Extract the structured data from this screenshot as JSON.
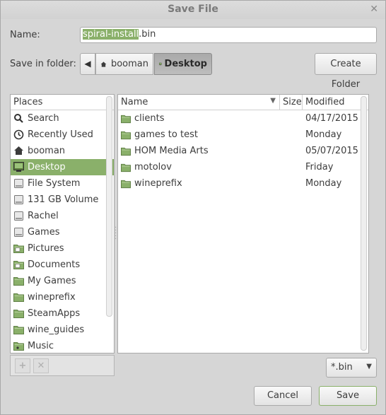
{
  "window": {
    "title": "Save File"
  },
  "name_field": {
    "label": "Name:",
    "selected_text": "spiral-install",
    "rest_text": ".bin"
  },
  "save_in": {
    "label": "Save in folder:",
    "crumbs": [
      "booman",
      "Desktop"
    ]
  },
  "create_folder_label": "Create Folder",
  "places": {
    "header": "Places",
    "items": [
      {
        "label": "Search",
        "icon": "search-icon"
      },
      {
        "label": "Recently Used",
        "icon": "clock-icon"
      },
      {
        "label": "booman",
        "icon": "home-icon"
      },
      {
        "label": "Desktop",
        "icon": "desktop-icon"
      },
      {
        "label": "File System",
        "icon": "drive-icon"
      },
      {
        "label": "131 GB Volume",
        "icon": "drive-icon"
      },
      {
        "label": "Rachel",
        "icon": "drive-icon"
      },
      {
        "label": "Games",
        "icon": "drive-icon"
      },
      {
        "label": "Pictures",
        "icon": "pictures-folder-icon"
      },
      {
        "label": "Documents",
        "icon": "documents-folder-icon"
      },
      {
        "label": "My Games",
        "icon": "folder-icon"
      },
      {
        "label": "wineprefix",
        "icon": "folder-icon"
      },
      {
        "label": "SteamApps",
        "icon": "folder-icon"
      },
      {
        "label": "wine_guides",
        "icon": "folder-icon"
      },
      {
        "label": "Music",
        "icon": "music-folder-icon"
      }
    ]
  },
  "files": {
    "columns": {
      "name": "Name",
      "size": "Size",
      "modified": "Modified"
    },
    "rows": [
      {
        "name": "clients",
        "modified": "04/17/2015"
      },
      {
        "name": "games to test",
        "modified": "Monday"
      },
      {
        "name": "HOM Media Arts",
        "modified": "05/07/2015"
      },
      {
        "name": "motolov",
        "modified": "Friday"
      },
      {
        "name": "wineprefix",
        "modified": "Monday"
      }
    ]
  },
  "filter": {
    "value": "*.bin"
  },
  "buttons": {
    "cancel": "Cancel",
    "save": "Save"
  },
  "colors": {
    "accent": "#8ab06a",
    "window_bg": "#d6d6d6"
  }
}
